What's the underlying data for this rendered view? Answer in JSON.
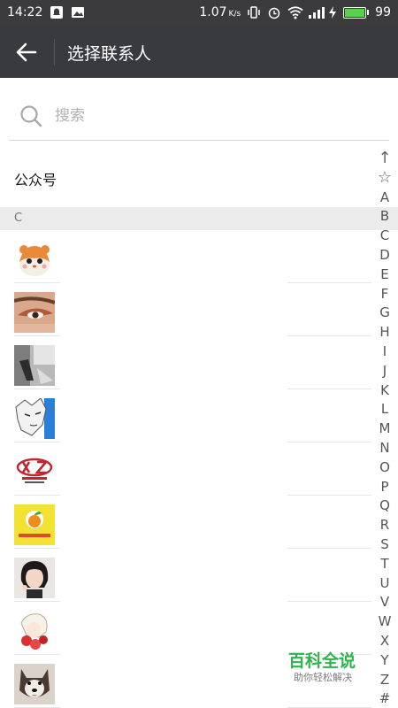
{
  "status_bar": {
    "time": "14:22",
    "net_speed": "1.07",
    "net_unit": "K/s",
    "battery_level": "99",
    "icons": [
      "notification-icon",
      "image-icon",
      "vibrate-icon",
      "alarm-icon",
      "wifi-icon",
      "signal-icon",
      "charging-icon",
      "battery-icon"
    ]
  },
  "header": {
    "back_icon": "arrow-left-icon",
    "title": "选择联系人"
  },
  "search": {
    "placeholder": "搜索",
    "value": ""
  },
  "public_accounts": {
    "label": "公众号"
  },
  "section": {
    "letter": "C"
  },
  "contacts": [
    {
      "avatar": "hamster-cartoon"
    },
    {
      "avatar": "eye-makeup-photo"
    },
    {
      "avatar": "grey-street-photo"
    },
    {
      "avatar": "anime-white-hair"
    },
    {
      "avatar": "chengxin-logo"
    },
    {
      "avatar": "orange-fruit-logo"
    },
    {
      "avatar": "woman-bob-haircut"
    },
    {
      "avatar": "anime-red-flowers"
    },
    {
      "avatar": "dog-photo"
    }
  ],
  "index_bar": {
    "letters": [
      "↑",
      "☆",
      "A",
      "B",
      "C",
      "D",
      "E",
      "F",
      "G",
      "H",
      "I",
      "J",
      "K",
      "L",
      "M",
      "N",
      "O",
      "P",
      "Q",
      "R",
      "S",
      "T",
      "U",
      "V",
      "W",
      "X",
      "Y",
      "Z",
      "#"
    ]
  },
  "watermark": {
    "title": "百科全说",
    "subtitle": "助你轻松解决"
  },
  "colors": {
    "status_bar": "#3b3b3d",
    "title_bar": "#393a3f",
    "section_header": "#ebebeb",
    "watermark_green": "#2fb34c",
    "battery_green": "#5ad14a"
  }
}
